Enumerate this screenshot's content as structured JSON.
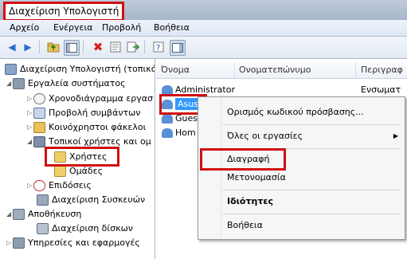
{
  "window": {
    "title": "Διαχείριση Υπολογιστή"
  },
  "menubar": {
    "items": [
      "Αρχείο",
      "Ενέργεια",
      "Προβολή",
      "Βοήθεια"
    ]
  },
  "toolbar": {
    "buttons": [
      "back-icon",
      "forward-icon",
      "up-folder-icon",
      "show-hide-tree-icon",
      "delete-icon",
      "properties-icon",
      "export-icon",
      "help-icon",
      "action-pane-icon"
    ]
  },
  "tree": {
    "root": "Διαχείριση Υπολογιστή (τοπικό",
    "system_tools": "Εργαλεία συστήματος",
    "task_scheduler": "Χρονοδιάγραμμα εργασ",
    "event_viewer": "Προβολή συμβάντων",
    "shared_folders": "Κοινόχρηστοι φάκελοι",
    "local_users": "Τοπικοί χρήστες και ομ",
    "users": "Χρήστες",
    "groups": "Ομάδες",
    "performance": "Επιδόσεις",
    "device_manager": "Διαχείριση Συσκευών",
    "storage": "Αποθήκευση",
    "disk_management": "Διαχείριση δίσκων",
    "services": "Υπηρεσίες και εφαρμογές"
  },
  "list": {
    "columns": [
      "Όνομα",
      "Ονοματεπώνυμο",
      "Περιγραφ"
    ],
    "rows": [
      {
        "name": "Administrator",
        "desc": "Ενσωματ"
      },
      {
        "name": "Asus",
        "desc": ""
      },
      {
        "name": "Guest",
        "desc": ""
      },
      {
        "name": "Hom",
        "desc": ""
      }
    ]
  },
  "context_menu": {
    "set_password": "Ορισμός κωδικού πρόσβασης...",
    "all_tasks": "Όλες οι εργασίες",
    "delete": "Διαγραφή",
    "rename": "Μετονομασία",
    "properties": "Ιδιότητες",
    "help": "Βοήθεια"
  },
  "colors": {
    "highlight": "#d01010",
    "selection": "#3399ff"
  }
}
